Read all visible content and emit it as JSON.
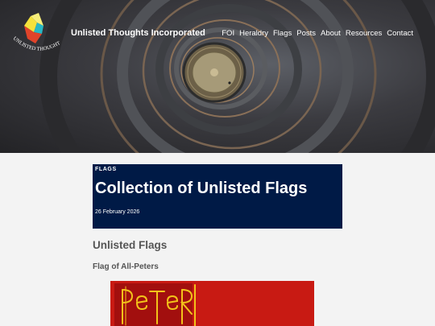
{
  "site": {
    "title": "Unlisted Thoughts Incorporated",
    "logo_text": "UNLISTED THOUGHTS"
  },
  "nav": {
    "items": [
      "FOI",
      "Heraldry",
      "Flags",
      "Posts",
      "About",
      "Resources",
      "Contact"
    ]
  },
  "post": {
    "category": "FLAGS",
    "title": "Collection of Unlisted Flags",
    "date": "26 February 2026"
  },
  "content": {
    "heading": "Unlisted Flags",
    "subheading": "Flag of All-Peters",
    "flag_lettering": "PeTeR"
  },
  "colors": {
    "banner": "#001a46",
    "flag_red": "#c81a13",
    "flag_yellow": "#f2c21a",
    "logo_yellow": "#f4e23b",
    "logo_cyan": "#27b8c5",
    "logo_red": "#e0432a"
  }
}
